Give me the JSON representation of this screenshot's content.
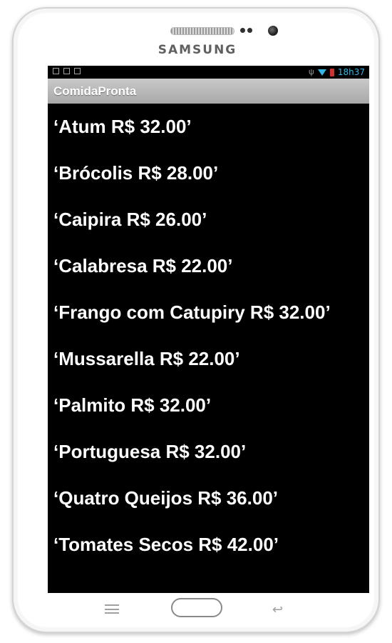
{
  "device": {
    "brand": "SAMSUNG"
  },
  "status_bar": {
    "time": "18h37",
    "wifi_color": "#33b5e5",
    "battery_color": "#d23030"
  },
  "app": {
    "title": "ComidaPronta"
  },
  "items": [
    {
      "label": "‘Atum R$ 32.00’"
    },
    {
      "label": "‘Brócolis R$ 28.00’"
    },
    {
      "label": "‘Caipira R$ 26.00’"
    },
    {
      "label": "‘Calabresa R$ 22.00’"
    },
    {
      "label": "‘Frango com Catupiry R$ 32.00’"
    },
    {
      "label": "‘Mussarella R$ 22.00’"
    },
    {
      "label": "‘Palmito R$ 32.00’"
    },
    {
      "label": "‘Portuguesa R$ 32.00’"
    },
    {
      "label": "‘Quatro Queijos R$ 36.00’"
    },
    {
      "label": "‘Tomates Secos R$ 42.00’"
    }
  ],
  "icons": {
    "notifications": [
      "image-icon",
      "bag-icon",
      "bag-icon"
    ],
    "nav": [
      "menu-icon",
      "home-button",
      "back-icon"
    ]
  }
}
